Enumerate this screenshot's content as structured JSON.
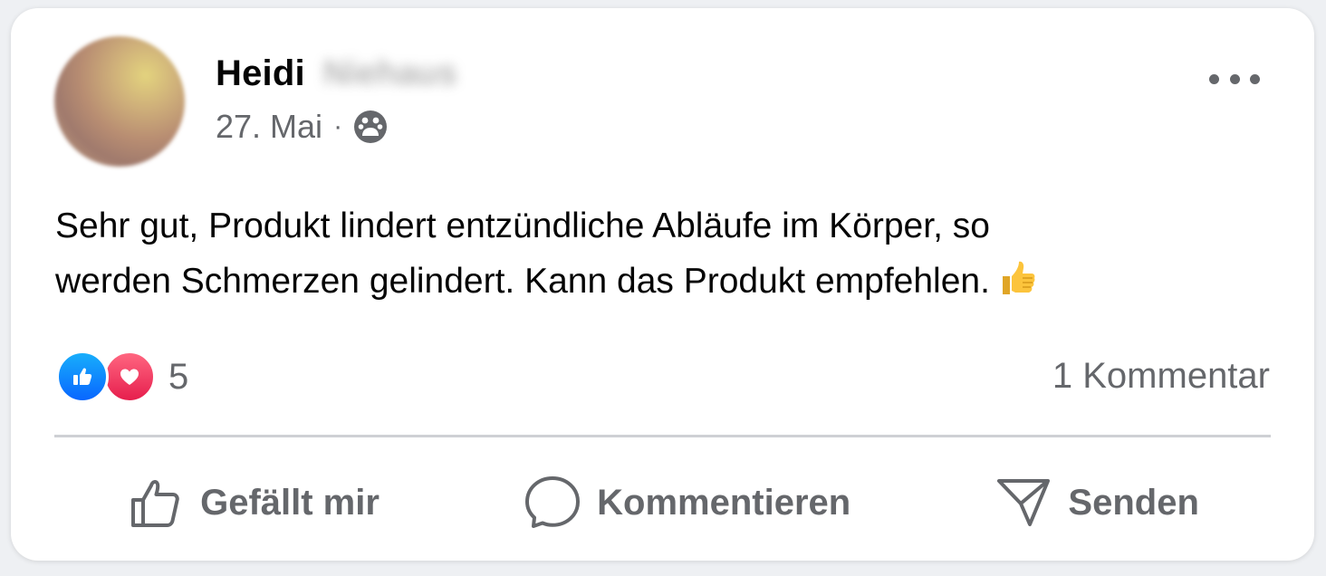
{
  "post": {
    "author_first_name": "Heidi",
    "author_last_name_blurred": "Niehaus",
    "date": "27. Mai",
    "meta_separator": "·",
    "audience_icon": "group-icon",
    "more_icon": "more-horizontal-icon",
    "text_line1": "Sehr gut, Produkt lindert entzündliche Abläufe im Körper, so",
    "text_line2": "werden Schmerzen gelindert. Kann das Produkt empfehlen.",
    "emoji": "thumbs-up-emoji"
  },
  "engagement": {
    "reaction_icons": [
      "like-reaction-icon",
      "love-reaction-icon"
    ],
    "reaction_count": "5",
    "comment_count_label": "1 Kommentar"
  },
  "actions": {
    "like_label": "Gefällt mir",
    "comment_label": "Kommentieren",
    "send_label": "Senden"
  },
  "colors": {
    "text_primary": "#050505",
    "text_secondary": "#65676b",
    "like_blue": "#0866ff",
    "love_red": "#e61e4d",
    "divider": "#ced0d4"
  }
}
